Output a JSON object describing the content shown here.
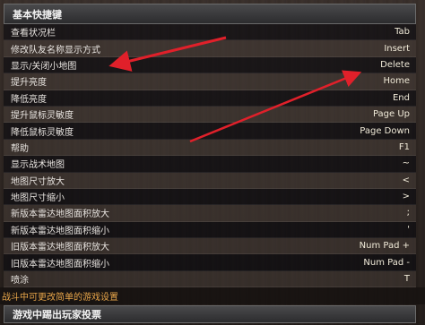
{
  "section_title": "基本快捷键",
  "bindings": [
    {
      "label": "查看状况栏",
      "key": "Tab"
    },
    {
      "label": "修改队友名称显示方式",
      "key": "Insert"
    },
    {
      "label": "显示/关闭小地图",
      "key": "Delete"
    },
    {
      "label": "提升亮度",
      "key": "Home"
    },
    {
      "label": "降低亮度",
      "key": "End"
    },
    {
      "label": "提升鼠标灵敏度",
      "key": "Page Up"
    },
    {
      "label": "降低鼠标灵敏度",
      "key": "Page Down"
    },
    {
      "label": "帮助",
      "key": "F1"
    },
    {
      "label": "显示战术地图",
      "key": "~"
    },
    {
      "label": "地图尺寸放大",
      "key": "<"
    },
    {
      "label": "地图尺寸缩小",
      "key": ">"
    },
    {
      "label": "新版本雷达地图面积放大",
      "key": ";"
    },
    {
      "label": "新版本雷达地图面积缩小",
      "key": "'"
    },
    {
      "label": "旧版本雷达地图面积放大",
      "key": "Num Pad +"
    },
    {
      "label": "旧版本雷达地图面积缩小",
      "key": "Num Pad -"
    },
    {
      "label": "喷涂",
      "key": "T"
    }
  ],
  "footer_link": "战斗中可更改简单的游戏设置",
  "footer_section": "游戏中踢出玩家投票",
  "colors": {
    "annotation_arrow": "#e0202a",
    "footer_link": "#e8a64a"
  }
}
